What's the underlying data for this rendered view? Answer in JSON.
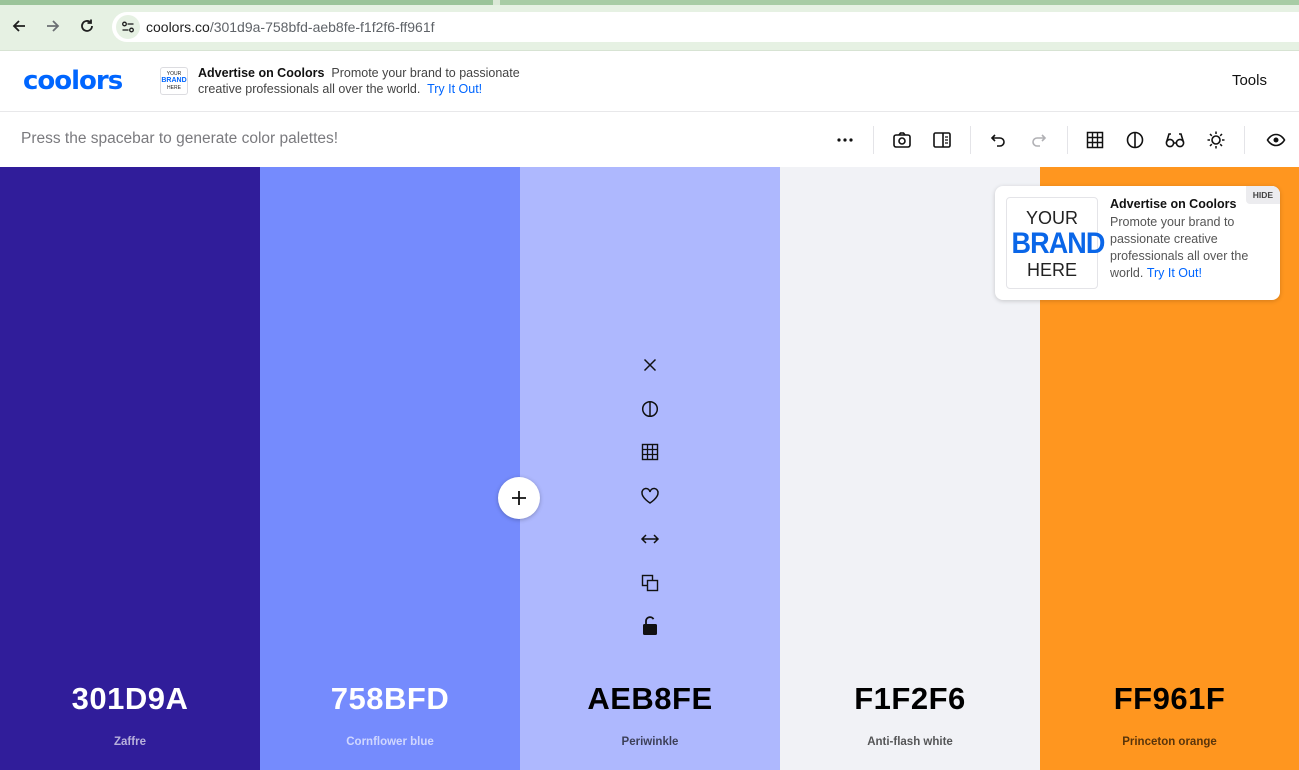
{
  "browser": {
    "url_host": "coolors.co",
    "url_path": "/301d9a-758bfd-aeb8fe-f1f2f6-ff961f"
  },
  "header": {
    "logo_text": "coolors",
    "ad": {
      "thumb_line1": "YOUR",
      "thumb_line2": "BRAND",
      "thumb_line3": "HERE",
      "title": "Advertise on Coolors",
      "body_line1": "Promote your brand to passionate",
      "body_line2": "creative professionals all over the world.",
      "link": "Try It Out!"
    },
    "tools_label": "Tools"
  },
  "toolbar": {
    "hint": "Press the spacebar to generate color palettes!",
    "icons": [
      "more-icon",
      "camera-icon",
      "side-panel-icon",
      "undo-icon",
      "redo-icon",
      "grid-icon",
      "contrast-icon",
      "glasses-icon",
      "brightness-icon",
      "eye-icon"
    ]
  },
  "palette": {
    "swatches": [
      {
        "hex": "301D9A",
        "name": "Zaffre",
        "color": "#301d9a",
        "text_color": "#ffffff"
      },
      {
        "hex": "758BFD",
        "name": "Cornflower blue",
        "color": "#758bfd",
        "text_color": "#ffffff"
      },
      {
        "hex": "AEB8FE",
        "name": "Periwinkle",
        "color": "#aeb8fe",
        "text_color": "#000000"
      },
      {
        "hex": "F1F2F6",
        "name": "Anti-flash white",
        "color": "#f1f2f6",
        "text_color": "#000000"
      },
      {
        "hex": "FF961F",
        "name": "Princeton orange",
        "color": "#ff961f",
        "text_color": "#000000"
      }
    ],
    "hover_tools": [
      "close-icon",
      "contrast-icon",
      "shades-grid-icon",
      "heart-icon",
      "drag-icon",
      "copy-icon",
      "unlock-icon"
    ]
  },
  "ad_card": {
    "img_line1": "YOUR",
    "img_line2": "BRAND",
    "img_line3": "HERE",
    "title": "Advertise on Coolors",
    "body": "Promote your brand to passionate creative professionals all over the world.",
    "link": "Try It Out!",
    "hide_label": "HIDE"
  }
}
